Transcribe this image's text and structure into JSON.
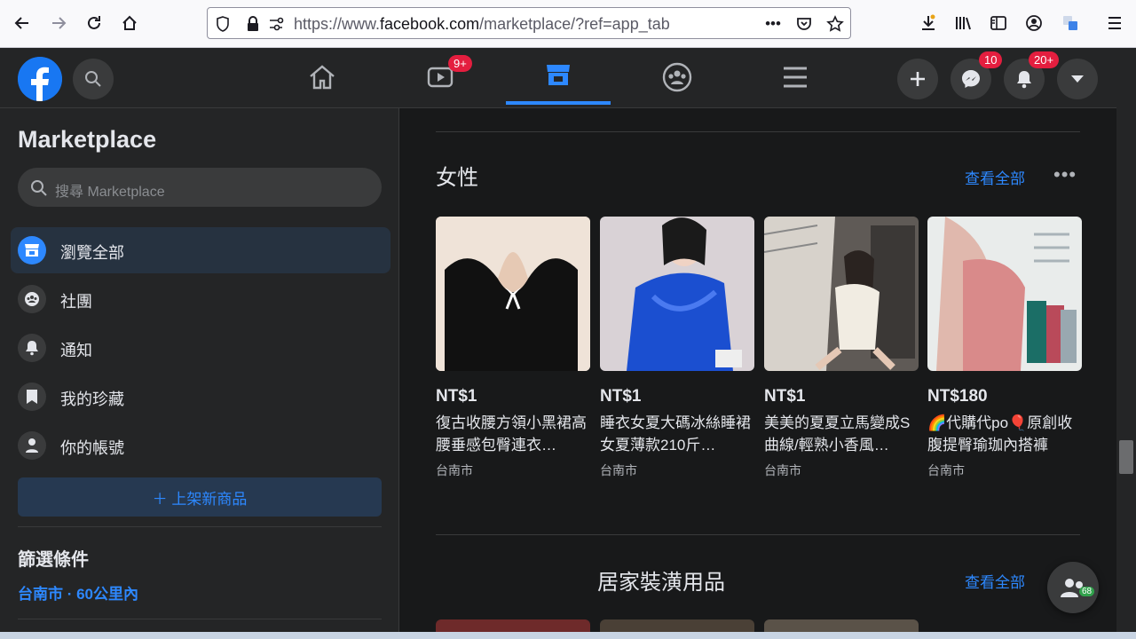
{
  "browser": {
    "url_prefix": "https://www.",
    "url_domain": "facebook.com",
    "url_path": "/marketplace/?ref=app_tab"
  },
  "header": {
    "watch_badge": "9+",
    "messenger_badge": "10",
    "notifications_badge": "20+"
  },
  "sidebar": {
    "title": "Marketplace",
    "search_placeholder": "搜尋 Marketplace",
    "items": [
      {
        "label": "瀏覽全部"
      },
      {
        "label": "社團"
      },
      {
        "label": "通知"
      },
      {
        "label": "我的珍藏"
      },
      {
        "label": "你的帳號"
      }
    ],
    "list_button": "＋ 上架新商品",
    "filters_title": "篩選條件",
    "location": "台南市 · 60公里內"
  },
  "main": {
    "section1": {
      "title": "女性",
      "see_all": "查看全部",
      "more": "•••",
      "listings": [
        {
          "price": "NT$1",
          "title": "復古收腰方領小黑裙高腰垂感包臀連衣…",
          "location": "台南市",
          "color": "#f1e6dc"
        },
        {
          "price": "NT$1",
          "title": "睡衣女夏大碼冰絲睡裙女夏薄款210斤…",
          "location": "台南市",
          "color": "#1d4fc4"
        },
        {
          "price": "NT$1",
          "title": "美美的夏夏立馬變成S曲線/輕熟小香風…",
          "location": "台南市",
          "color": "#7a7470"
        },
        {
          "price": "NT$180",
          "title": "🌈代購代po🎈原創收腹提臀瑜珈內搭褲",
          "location": "台南市",
          "color": "#e3a3a3"
        }
      ]
    },
    "section2": {
      "title": "居家裝潢用品",
      "see_all": "查看全部"
    }
  },
  "contacts_badge": "68"
}
